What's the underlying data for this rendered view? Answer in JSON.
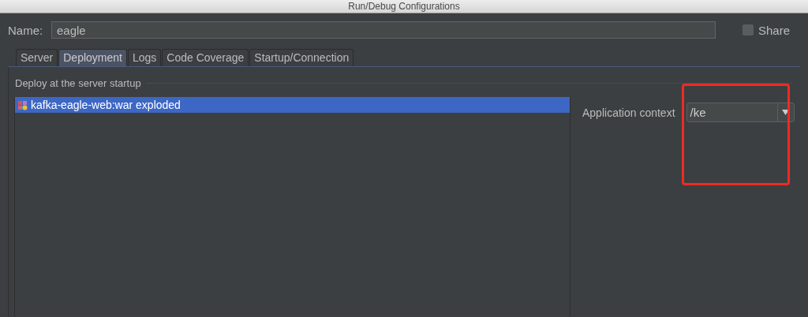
{
  "window": {
    "title": "Run/Debug Configurations"
  },
  "name_field": {
    "label": "Name:",
    "value": "eagle"
  },
  "share": {
    "label": "Share",
    "checked": false
  },
  "tabs": [
    {
      "label": "Server",
      "selected": false
    },
    {
      "label": "Deployment",
      "selected": true
    },
    {
      "label": "Logs",
      "selected": false
    },
    {
      "label": "Code Coverage",
      "selected": false
    },
    {
      "label": "Startup/Connection",
      "selected": false
    }
  ],
  "section": {
    "title": "Deploy at the server startup"
  },
  "artifacts": [
    {
      "label": "kafka-eagle-web:war exploded",
      "selected": true
    }
  ],
  "application_context": {
    "label": "Application context",
    "value": "/ke"
  },
  "annotation": {
    "kind": "highlight-frame"
  }
}
